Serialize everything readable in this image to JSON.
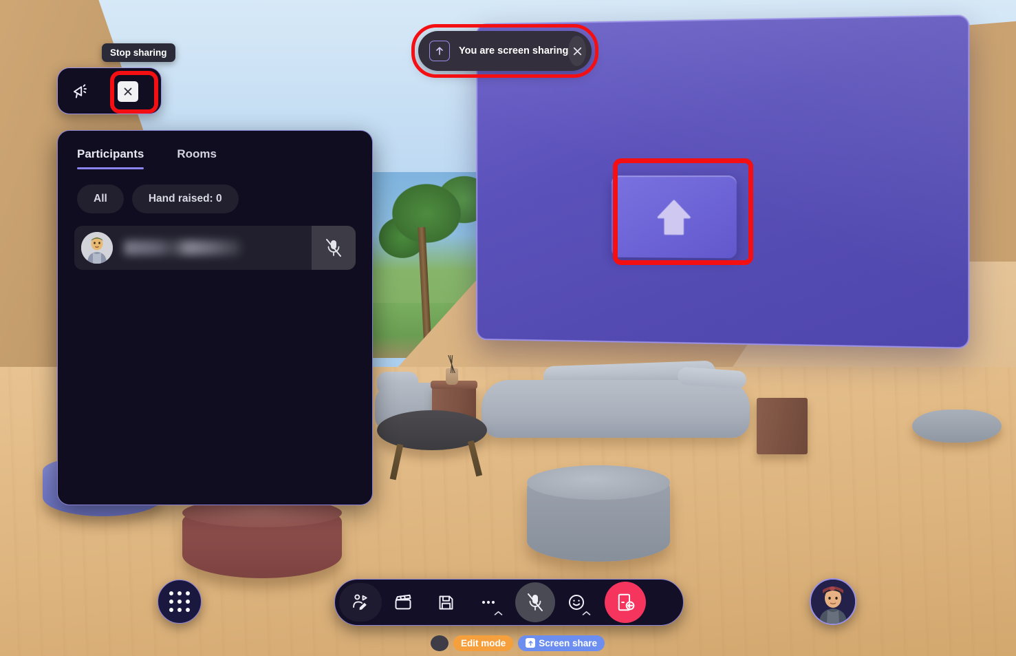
{
  "app": {
    "environment_name": "virtual-meeting-room-3d"
  },
  "tooltip": {
    "label": "Stop sharing"
  },
  "announce_bar": {
    "announce_icon": "megaphone-icon",
    "stop_share_icon": "close-x-icon"
  },
  "toast": {
    "icon": "screen-share-upload-icon",
    "message": "You are screen sharing",
    "close_icon": "close-x-icon"
  },
  "panel": {
    "tabs": [
      {
        "label": "Participants",
        "active": true
      },
      {
        "label": "Rooms",
        "active": false
      }
    ],
    "filters": [
      {
        "label": "All"
      },
      {
        "label": "Hand raised: 0"
      }
    ],
    "participants": [
      {
        "name": "",
        "name_redacted": true,
        "avatar": "participant-avatar",
        "mic_state": "muted"
      }
    ]
  },
  "big_screen": {
    "placeholder_icon": "upload-arrow-icon"
  },
  "launcher": {
    "icon": "apps-grid-icon"
  },
  "toolbar": {
    "items": [
      {
        "icon": "avatar-edit-icon",
        "name": "avatar-edit-button"
      },
      {
        "icon": "clapperboard-icon",
        "name": "media-button"
      },
      {
        "icon": "floppy-save-icon",
        "name": "save-button"
      },
      {
        "icon": "more-dots-icon",
        "name": "more-options-button"
      },
      {
        "icon": "microphone-muted-icon",
        "name": "microphone-button"
      },
      {
        "icon": "emoji-smile-icon",
        "name": "reactions-button"
      },
      {
        "icon": "leave-door-icon",
        "name": "leave-button"
      }
    ]
  },
  "me_avatar": {
    "label": "my-avatar"
  },
  "statusbar": {
    "badges": [
      {
        "label": "Edit mode",
        "color": "#f5a03c",
        "icon": null
      },
      {
        "label": "Screen share",
        "color": "#6b8ef0",
        "icon": "upload-small-icon"
      }
    ]
  },
  "colors": {
    "accent_purple": "#8b83f0",
    "panel_bg": "#0f0d1f",
    "annotation_red": "#f40f12",
    "leave_red": "#f5355e",
    "edit_mode_orange": "#f5a03c",
    "screen_share_blue": "#6b8ef0",
    "big_screen_purple": "#5b51ba"
  }
}
